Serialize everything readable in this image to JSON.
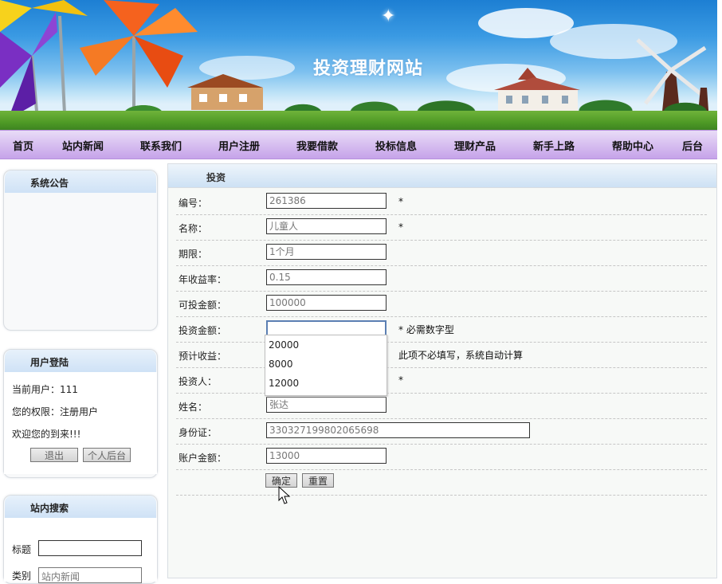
{
  "banner": {
    "title": "投资理财网站"
  },
  "nav": {
    "items": [
      "首页",
      "站内新闻",
      "联系我们",
      "用户注册",
      "我要借款",
      "投标信息",
      "理财产品",
      "新手上路",
      "帮助中心",
      "后台"
    ]
  },
  "announcement": {
    "title": "系统公告"
  },
  "login": {
    "title": "用户登陆",
    "current_user": "当前用户：111",
    "permission": "您的权限：注册用户",
    "welcome": "欢迎您的到来!!!",
    "logout_label": "退出",
    "backend_label": "个人后台"
  },
  "search": {
    "title": "站内搜索",
    "title_label": "标题",
    "title_value": "",
    "category_label": "类别",
    "category_value": "站内新闻"
  },
  "form": {
    "header": "投资",
    "fields": [
      {
        "label": "编号：",
        "value": "261386",
        "required": "*"
      },
      {
        "label": "名称：",
        "value": "儿童人",
        "required": "*"
      },
      {
        "label": "期限：",
        "value": "1个月"
      },
      {
        "label": "年收益率：",
        "value": "0.15"
      },
      {
        "label": "可投金额：",
        "value": "100000"
      },
      {
        "label": "投资金额：",
        "value": "",
        "note": "* 必需数字型"
      },
      {
        "label": "预计收益：",
        "value": "",
        "note": "此项不必填写，系统自动计算"
      },
      {
        "label": "投资人：",
        "value": "",
        "required": "*"
      },
      {
        "label": "姓名：",
        "value": "张达"
      },
      {
        "label": "身份证：",
        "value": "330327199802065698"
      },
      {
        "label": "账户金额：",
        "value": "13000"
      }
    ],
    "autocomplete": [
      "20000",
      "8000",
      "12000"
    ],
    "submit_label": "确定",
    "reset_label": "重置"
  }
}
